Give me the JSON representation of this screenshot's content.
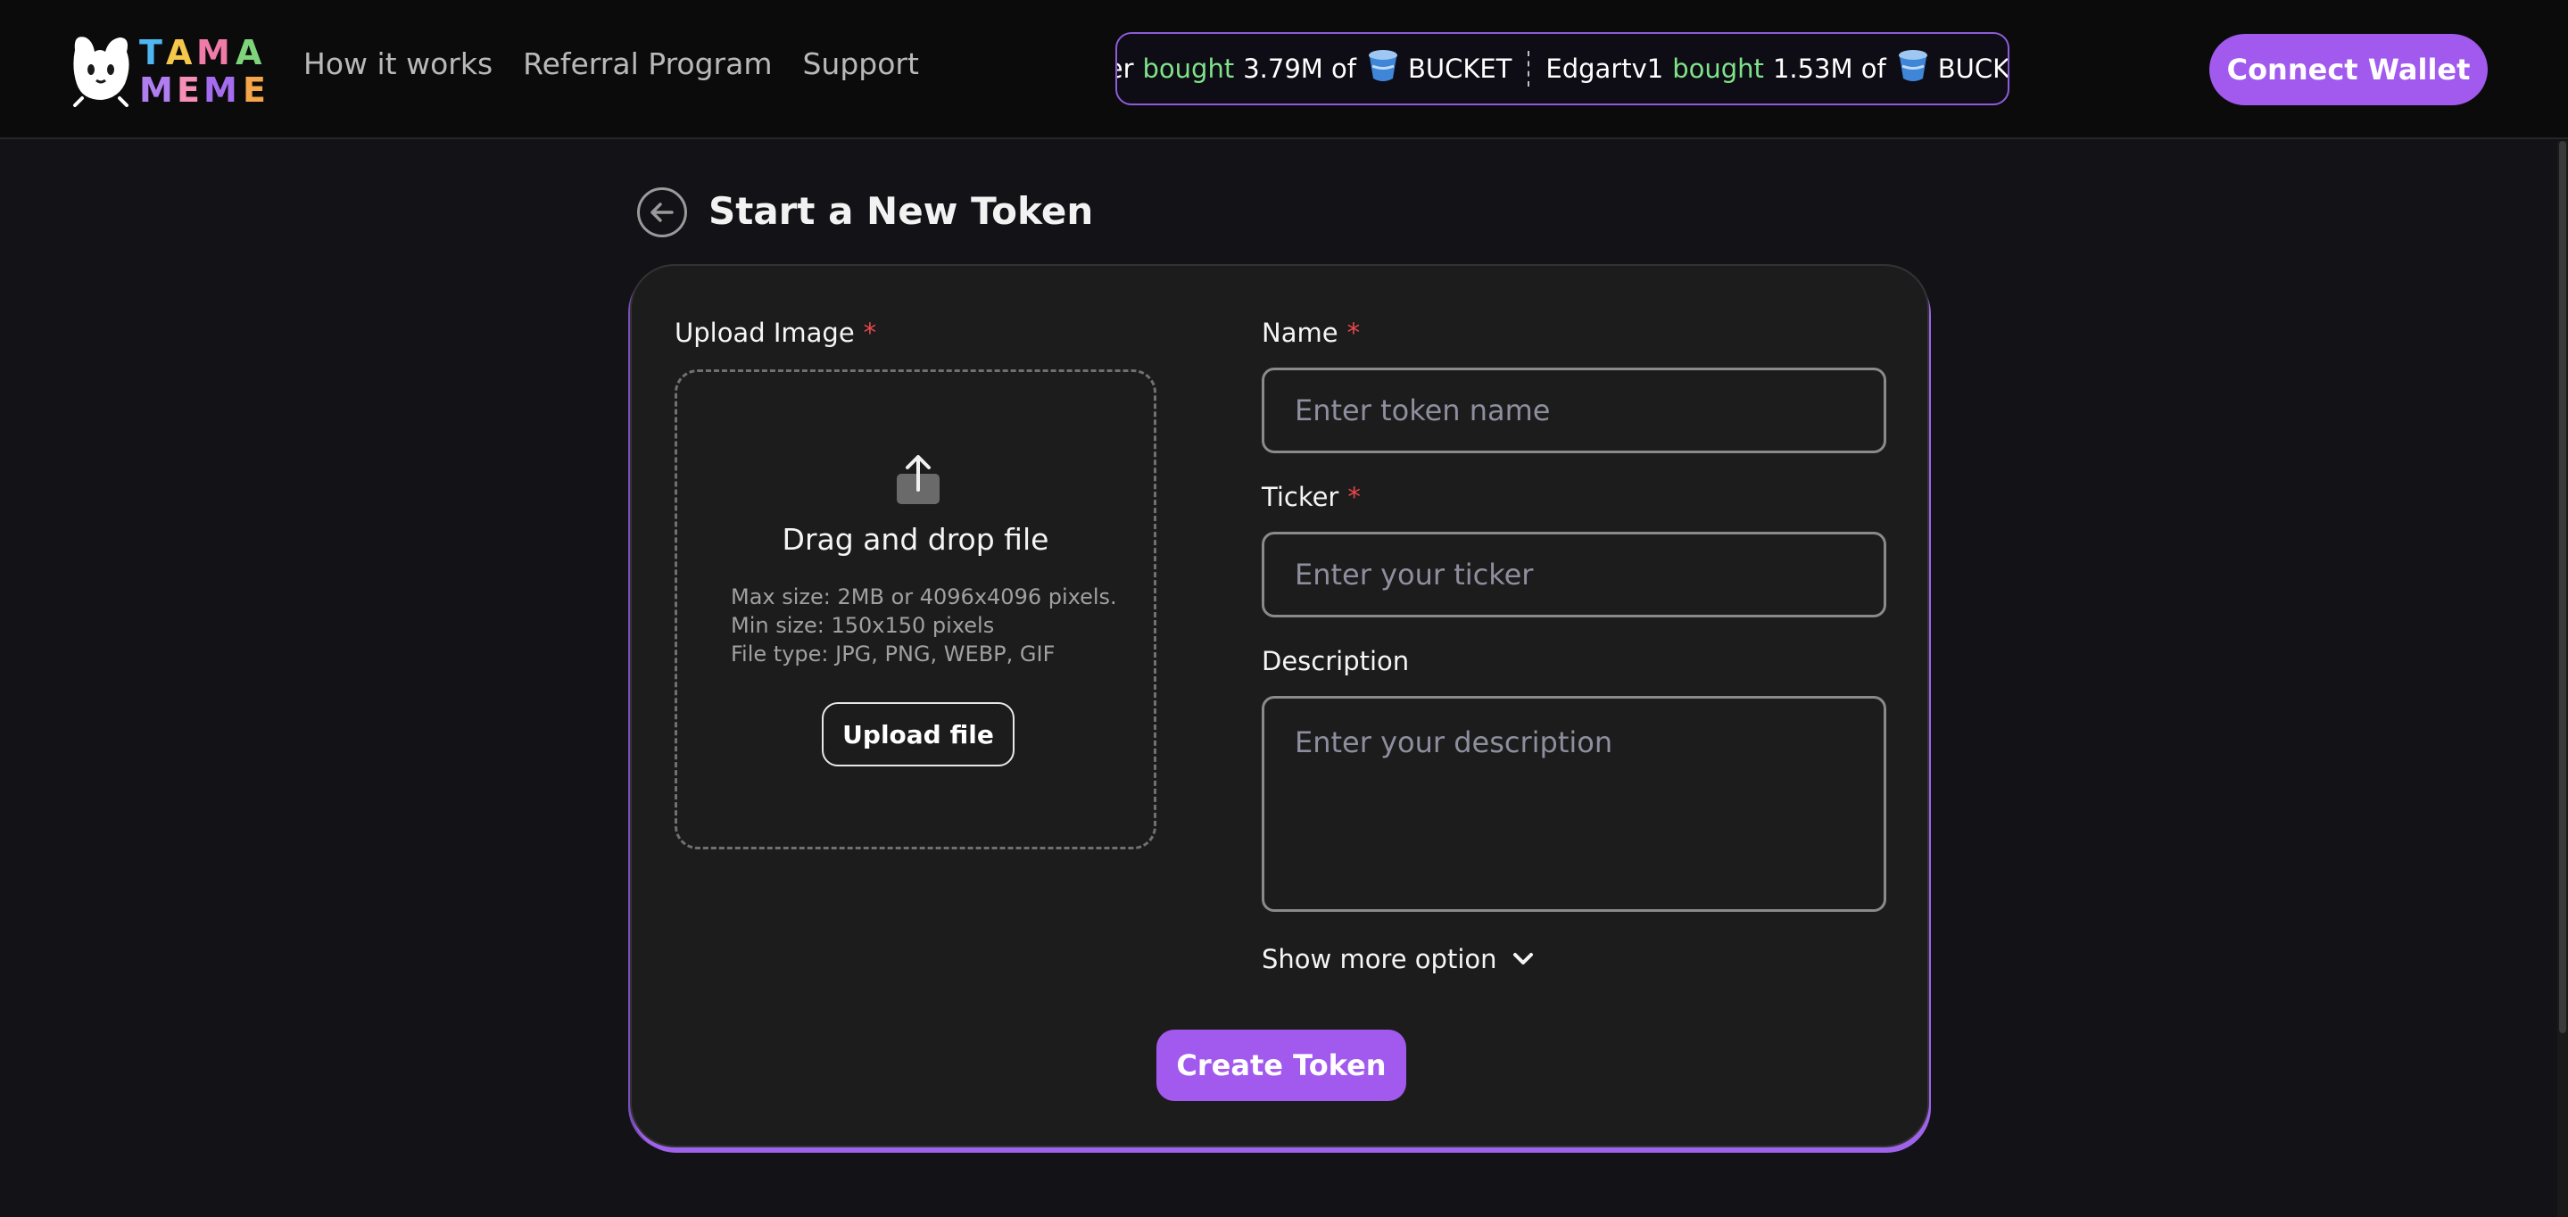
{
  "header": {
    "logo_alt": "TAMA MEME",
    "nav": [
      {
        "label": "How it works"
      },
      {
        "label": "Referral Program"
      },
      {
        "label": "Support"
      }
    ],
    "ticker": [
      {
        "user": "alover",
        "action": "bought",
        "amount": "3.79M of",
        "token": "BUCKET"
      },
      {
        "user": "Edgartv1",
        "action": "bought",
        "amount": "1.53M of",
        "token": "BUCKET"
      }
    ],
    "connect_label": "Connect Wallet"
  },
  "page": {
    "title": "Start a New Token"
  },
  "form": {
    "upload": {
      "label": "Upload Image",
      "required_mark": "*",
      "title": "Drag and drop file",
      "info_max": "Max size: 2MB or 4096x4096 pixels.",
      "info_min": "Min size: 150x150 pixels",
      "info_type": "File type: JPG, PNG, WEBP, GIF",
      "button_label": "Upload file"
    },
    "name": {
      "label": "Name",
      "required_mark": "*",
      "placeholder": "Enter token name",
      "value": ""
    },
    "ticker": {
      "label": "Ticker",
      "required_mark": "*",
      "placeholder": "Enter your ticker",
      "value": ""
    },
    "description": {
      "label": "Description",
      "placeholder": "Enter your description",
      "value": ""
    },
    "show_more_label": "Show more option",
    "create_label": "Create Token"
  },
  "colors": {
    "accent": "#a259ee",
    "buy_green": "#7fe38a",
    "required_red": "#e5484d",
    "card_bg": "#1c1c1c",
    "page_bg": "#131217"
  }
}
